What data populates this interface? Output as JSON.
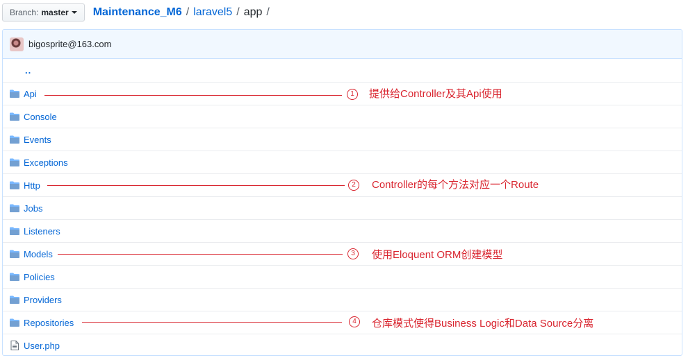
{
  "branch": {
    "prefix": "Branch:",
    "name": "master"
  },
  "breadcrumb": {
    "repo": "Maintenance_M6",
    "sep1": "/",
    "folder": "laravel5",
    "sep2": "/",
    "current": "app",
    "sep3": "/"
  },
  "commit": {
    "author": "bigosprite@163.com"
  },
  "files": [
    {
      "name": "..",
      "type": "parent"
    },
    {
      "name": "Api",
      "type": "folder"
    },
    {
      "name": "Console",
      "type": "folder"
    },
    {
      "name": "Events",
      "type": "folder"
    },
    {
      "name": "Exceptions",
      "type": "folder"
    },
    {
      "name": "Http",
      "type": "folder"
    },
    {
      "name": "Jobs",
      "type": "folder"
    },
    {
      "name": "Listeners",
      "type": "folder"
    },
    {
      "name": "Models",
      "type": "folder"
    },
    {
      "name": "Policies",
      "type": "folder"
    },
    {
      "name": "Providers",
      "type": "folder"
    },
    {
      "name": "Repositories",
      "type": "folder"
    },
    {
      "name": "User.php",
      "type": "file"
    }
  ],
  "annotations": [
    {
      "marker": "1",
      "text": "提供给Controller及其Api使用"
    },
    {
      "marker": "2",
      "text": "Controller的每个方法对应一个Route"
    },
    {
      "marker": "3",
      "text": "使用Eloquent ORM创建模型"
    },
    {
      "marker": "4",
      "text": "仓库模式使得Business Logic和Data Source分离"
    }
  ],
  "colors": {
    "link": "#0366d6",
    "annotation": "#d9252f",
    "folder_icon": "#79b8ff",
    "header_bg": "#f1f8ff"
  }
}
